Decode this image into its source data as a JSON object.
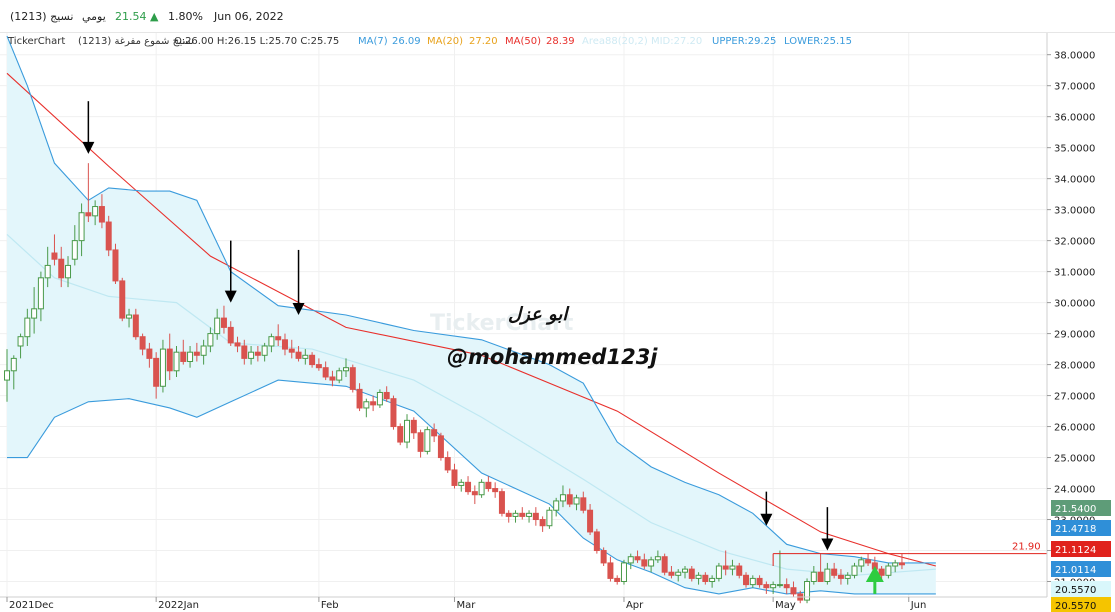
{
  "header": {
    "symbol": "نسيج (1213)",
    "period": "يومي",
    "price": "21.54",
    "change_arrow": "▲",
    "change": "1.80%",
    "date": "Jun 06, 2022"
  },
  "legend": {
    "source": "TickerChart",
    "description": "نسيج شموع مفرغة (1213)",
    "ohlc": "O:26.00 H:26.15 L:25.70 C:25.75",
    "ma7": "MA(7)",
    "ma7_value": "26.09",
    "ma20": "MA(20)",
    "ma20_value": "27.20",
    "ma50": "MA(50)",
    "ma50_value": "28.39",
    "faded": "Area88(20,2) MID:27.20",
    "upper": "UPPER:29.25",
    "lower": "LOWER:25.15"
  },
  "colors": {
    "up": "#4a9a4a",
    "down": "#d9534f",
    "ma50": "#e8302c",
    "band": "#3a9bdc",
    "band_fill": "#e3f6fb",
    "mid": "#bfe8f2",
    "accent_green": "#2ecc40"
  },
  "annotations": {
    "author_arabic": "ابو عزل",
    "handle": "@mohammed123j",
    "watermark": "TickerChart",
    "resistance_label": "21.90"
  },
  "price_tags": [
    {
      "label": "21.5400",
      "value": 21.54,
      "bg": "#5e9c78"
    },
    {
      "label": "21.4718",
      "value": 21.4718,
      "bg": "#2f8fd8"
    },
    {
      "label": "21.1124",
      "value": 21.1124,
      "bg": "#e0221c"
    },
    {
      "label": "21.0114",
      "value": 21.0114,
      "bg": "#2f8fd8"
    },
    {
      "label": "20.5570",
      "value": 20.557,
      "bg": "#d9f7fb"
    },
    {
      "label": "20.5570",
      "value": 20.557,
      "bg": "#f5c400"
    }
  ],
  "chart_data": {
    "type": "candlestick",
    "ylim": [
      20.5,
      38.7
    ],
    "y_ticks": [
      38,
      37,
      36,
      35,
      34,
      33,
      32,
      31,
      30,
      29,
      28,
      27,
      26,
      25,
      24,
      23,
      22,
      21
    ],
    "x_month_labels": [
      {
        "label": "2021Dec",
        "index": 0
      },
      {
        "label": "2022Jan",
        "index": 22
      },
      {
        "label": "Feb",
        "index": 46
      },
      {
        "label": "Mar",
        "index": 66
      },
      {
        "label": "Apr",
        "index": 91
      },
      {
        "label": "May",
        "index": 113
      },
      {
        "label": "Jun",
        "index": 133
      }
    ],
    "candles": [
      [
        27.5,
        28.5,
        26.8,
        27.8
      ],
      [
        27.8,
        28.3,
        27.2,
        28.2
      ],
      [
        28.6,
        29.0,
        28.2,
        28.9
      ],
      [
        28.9,
        29.8,
        28.6,
        29.5
      ],
      [
        29.5,
        30.5,
        29.0,
        29.8
      ],
      [
        29.8,
        31.0,
        29.4,
        30.8
      ],
      [
        30.8,
        31.8,
        30.5,
        31.2
      ],
      [
        31.6,
        32.2,
        31.2,
        31.4
      ],
      [
        31.4,
        31.8,
        30.5,
        30.8
      ],
      [
        30.8,
        31.5,
        30.5,
        31.2
      ],
      [
        31.4,
        32.5,
        31.2,
        32.0
      ],
      [
        32.0,
        33.2,
        31.5,
        32.9
      ],
      [
        32.9,
        34.5,
        32.6,
        32.8
      ],
      [
        32.8,
        33.3,
        32.5,
        33.1
      ],
      [
        33.1,
        33.5,
        32.4,
        32.6
      ],
      [
        32.6,
        32.8,
        31.5,
        31.7
      ],
      [
        31.7,
        31.9,
        30.6,
        30.7
      ],
      [
        30.7,
        30.8,
        29.4,
        29.5
      ],
      [
        29.5,
        29.8,
        29.2,
        29.6
      ],
      [
        29.6,
        29.8,
        28.8,
        28.9
      ],
      [
        28.9,
        29.0,
        28.3,
        28.5
      ],
      [
        28.5,
        28.7,
        27.9,
        28.2
      ],
      [
        28.2,
        28.4,
        26.9,
        27.3
      ],
      [
        27.3,
        28.8,
        27.1,
        28.5
      ],
      [
        28.5,
        29.0,
        27.5,
        27.8
      ],
      [
        27.8,
        28.6,
        27.6,
        28.4
      ],
      [
        28.4,
        28.8,
        28.0,
        28.1
      ],
      [
        28.1,
        28.6,
        27.9,
        28.4
      ],
      [
        28.4,
        28.7,
        28.1,
        28.3
      ],
      [
        28.3,
        28.8,
        28.0,
        28.6
      ],
      [
        28.6,
        29.2,
        28.4,
        29.0
      ],
      [
        29.0,
        29.8,
        28.8,
        29.5
      ],
      [
        29.5,
        29.9,
        29.0,
        29.2
      ],
      [
        29.2,
        29.4,
        28.6,
        28.7
      ],
      [
        28.7,
        28.9,
        28.4,
        28.6
      ],
      [
        28.6,
        28.8,
        28.0,
        28.2
      ],
      [
        28.2,
        28.6,
        28.0,
        28.4
      ],
      [
        28.4,
        28.6,
        28.1,
        28.3
      ],
      [
        28.3,
        28.7,
        28.1,
        28.6
      ],
      [
        28.6,
        29.0,
        28.4,
        28.9
      ],
      [
        28.9,
        29.3,
        28.6,
        28.8
      ],
      [
        28.8,
        29.0,
        28.3,
        28.5
      ],
      [
        28.5,
        28.8,
        28.2,
        28.4
      ],
      [
        28.4,
        28.6,
        28.1,
        28.2
      ],
      [
        28.2,
        28.5,
        28.0,
        28.3
      ],
      [
        28.3,
        28.4,
        27.9,
        28.0
      ],
      [
        28.0,
        28.2,
        27.8,
        27.9
      ],
      [
        27.9,
        28.1,
        27.5,
        27.6
      ],
      [
        27.6,
        27.8,
        27.3,
        27.5
      ],
      [
        27.5,
        27.9,
        27.4,
        27.8
      ],
      [
        27.8,
        28.2,
        27.6,
        27.9
      ],
      [
        27.9,
        28.0,
        27.1,
        27.2
      ],
      [
        27.2,
        27.4,
        26.5,
        26.6
      ],
      [
        26.6,
        26.9,
        26.3,
        26.8
      ],
      [
        26.8,
        27.0,
        26.5,
        26.7
      ],
      [
        26.7,
        27.2,
        26.6,
        27.1
      ],
      [
        27.1,
        27.3,
        26.8,
        26.9
      ],
      [
        26.9,
        27.0,
        25.9,
        26.0
      ],
      [
        26.0,
        26.1,
        25.4,
        25.5
      ],
      [
        25.5,
        26.4,
        25.3,
        26.2
      ],
      [
        26.2,
        26.3,
        25.6,
        25.8
      ],
      [
        25.8,
        25.9,
        25.0,
        25.2
      ],
      [
        25.2,
        26.0,
        25.1,
        25.9
      ],
      [
        25.9,
        26.1,
        25.5,
        25.7
      ],
      [
        25.7,
        25.8,
        24.9,
        25.0
      ],
      [
        25.0,
        25.2,
        24.5,
        24.6
      ],
      [
        24.6,
        24.8,
        24.0,
        24.1
      ],
      [
        24.1,
        24.3,
        23.9,
        24.2
      ],
      [
        24.2,
        24.4,
        23.8,
        23.9
      ],
      [
        23.9,
        24.1,
        23.5,
        23.8
      ],
      [
        23.8,
        24.3,
        23.7,
        24.2
      ],
      [
        24.2,
        24.4,
        23.9,
        24.0
      ],
      [
        24.0,
        24.2,
        23.7,
        23.9
      ],
      [
        23.9,
        24.0,
        23.1,
        23.2
      ],
      [
        23.2,
        23.3,
        22.9,
        23.1
      ],
      [
        23.1,
        23.3,
        22.9,
        23.2
      ],
      [
        23.2,
        23.4,
        23.0,
        23.1
      ],
      [
        23.1,
        23.3,
        22.9,
        23.2
      ],
      [
        23.2,
        23.4,
        22.8,
        23.0
      ],
      [
        23.0,
        23.1,
        22.6,
        22.8
      ],
      [
        22.8,
        23.4,
        22.7,
        23.3
      ],
      [
        23.3,
        23.7,
        23.1,
        23.6
      ],
      [
        23.6,
        24.1,
        23.4,
        23.8
      ],
      [
        23.8,
        24.0,
        23.4,
        23.5
      ],
      [
        23.5,
        23.8,
        23.3,
        23.7
      ],
      [
        23.7,
        23.9,
        23.2,
        23.3
      ],
      [
        23.3,
        23.5,
        22.5,
        22.6
      ],
      [
        22.6,
        22.7,
        21.9,
        22.0
      ],
      [
        22.0,
        22.1,
        21.5,
        21.6
      ],
      [
        21.6,
        21.8,
        21.0,
        21.1
      ],
      [
        21.1,
        21.2,
        20.9,
        21.0
      ],
      [
        21.0,
        21.7,
        20.9,
        21.6
      ],
      [
        21.6,
        21.9,
        21.4,
        21.8
      ],
      [
        21.8,
        22.0,
        21.6,
        21.7
      ],
      [
        21.7,
        21.9,
        21.4,
        21.5
      ],
      [
        21.5,
        21.8,
        21.3,
        21.7
      ],
      [
        21.7,
        22.0,
        21.6,
        21.8
      ],
      [
        21.8,
        21.9,
        21.2,
        21.3
      ],
      [
        21.3,
        21.5,
        21.1,
        21.2
      ],
      [
        21.2,
        21.4,
        21.0,
        21.3
      ],
      [
        21.3,
        21.5,
        21.1,
        21.4
      ],
      [
        21.4,
        21.5,
        21.0,
        21.1
      ],
      [
        21.1,
        21.3,
        20.9,
        21.2
      ],
      [
        21.2,
        21.3,
        20.9,
        21.0
      ],
      [
        21.0,
        21.2,
        20.8,
        21.1
      ],
      [
        21.1,
        21.6,
        21.0,
        21.5
      ],
      [
        21.5,
        22.0,
        21.2,
        21.4
      ],
      [
        21.4,
        21.7,
        21.2,
        21.5
      ],
      [
        21.5,
        21.6,
        21.1,
        21.2
      ],
      [
        21.2,
        21.3,
        20.8,
        20.9
      ],
      [
        20.9,
        21.2,
        20.8,
        21.1
      ],
      [
        21.1,
        21.2,
        20.8,
        20.9
      ],
      [
        20.9,
        21.0,
        20.6,
        20.8
      ],
      [
        20.8,
        21.0,
        20.6,
        20.9
      ],
      [
        20.9,
        22.0,
        20.8,
        20.9
      ],
      [
        20.9,
        21.1,
        20.6,
        20.8
      ],
      [
        20.8,
        21.0,
        20.5,
        20.6
      ],
      [
        20.6,
        20.7,
        20.3,
        20.4
      ],
      [
        20.4,
        21.1,
        20.3,
        21.0
      ],
      [
        21.0,
        21.5,
        20.9,
        21.3
      ],
      [
        21.3,
        21.9,
        21.1,
        21.0
      ],
      [
        21.0,
        21.6,
        20.9,
        21.4
      ],
      [
        21.4,
        21.6,
        21.1,
        21.2
      ],
      [
        21.2,
        21.4,
        20.9,
        21.1
      ],
      [
        21.1,
        21.3,
        20.9,
        21.2
      ],
      [
        21.2,
        21.6,
        21.1,
        21.5
      ],
      [
        21.5,
        21.8,
        21.3,
        21.7
      ],
      [
        21.7,
        21.9,
        21.5,
        21.6
      ],
      [
        21.6,
        21.8,
        21.3,
        21.4
      ],
      [
        21.4,
        21.5,
        21.0,
        21.2
      ],
      [
        21.2,
        21.6,
        21.1,
        21.5
      ],
      [
        21.5,
        21.7,
        21.3,
        21.6
      ],
      [
        21.6,
        21.9,
        21.4,
        21.54
      ]
    ],
    "series": [
      {
        "name": "MA(50)",
        "color": "#e8302c",
        "points": [
          [
            0,
            37.4
          ],
          [
            15,
            34.4
          ],
          [
            30,
            31.5
          ],
          [
            50,
            29.2
          ],
          [
            70,
            28.3
          ],
          [
            90,
            26.5
          ],
          [
            105,
            24.5
          ],
          [
            120,
            22.6
          ],
          [
            130,
            21.9
          ],
          [
            137,
            21.5
          ]
        ]
      },
      {
        "name": "UPPER",
        "color": "#3a9bdc",
        "points": [
          [
            0,
            38.6
          ],
          [
            3,
            37.0
          ],
          [
            7,
            34.5
          ],
          [
            12,
            33.3
          ],
          [
            15,
            33.7
          ],
          [
            20,
            33.6
          ],
          [
            24,
            33.6
          ],
          [
            28,
            33.3
          ],
          [
            33,
            31.0
          ],
          [
            40,
            29.9
          ],
          [
            50,
            29.6
          ],
          [
            60,
            29.1
          ],
          [
            70,
            28.8
          ],
          [
            80,
            28.0
          ],
          [
            85,
            27.4
          ],
          [
            90,
            25.5
          ],
          [
            95,
            24.7
          ],
          [
            100,
            24.2
          ],
          [
            105,
            23.8
          ],
          [
            110,
            23.2
          ],
          [
            115,
            22.2
          ],
          [
            120,
            21.9
          ],
          [
            125,
            21.8
          ],
          [
            130,
            21.6
          ],
          [
            137,
            21.6
          ]
        ]
      },
      {
        "name": "LOWER",
        "color": "#3a9bdc",
        "points": [
          [
            0,
            25.0
          ],
          [
            3,
            25.0
          ],
          [
            7,
            26.3
          ],
          [
            12,
            26.8
          ],
          [
            18,
            26.9
          ],
          [
            24,
            26.6
          ],
          [
            28,
            26.3
          ],
          [
            33,
            26.8
          ],
          [
            40,
            27.5
          ],
          [
            50,
            27.3
          ],
          [
            60,
            26.5
          ],
          [
            70,
            24.5
          ],
          [
            80,
            23.5
          ],
          [
            85,
            22.4
          ],
          [
            90,
            21.7
          ],
          [
            95,
            21.3
          ],
          [
            100,
            20.8
          ],
          [
            105,
            20.6
          ],
          [
            110,
            20.8
          ],
          [
            115,
            20.6
          ],
          [
            120,
            20.7
          ],
          [
            125,
            20.6
          ],
          [
            130,
            20.6
          ],
          [
            137,
            20.6
          ]
        ]
      },
      {
        "name": "MID",
        "color": "#bfe8f2",
        "points": [
          [
            0,
            32.2
          ],
          [
            7,
            30.8
          ],
          [
            15,
            30.2
          ],
          [
            25,
            30.0
          ],
          [
            33,
            28.7
          ],
          [
            45,
            28.5
          ],
          [
            60,
            27.5
          ],
          [
            70,
            26.3
          ],
          [
            85,
            24.3
          ],
          [
            95,
            22.9
          ],
          [
            105,
            22.0
          ],
          [
            115,
            21.4
          ],
          [
            125,
            21.2
          ],
          [
            137,
            21.4
          ]
        ]
      }
    ],
    "resistance_line": 21.9,
    "resistance_from_index": 113,
    "down_arrows": [
      {
        "index": 12,
        "y_top": 36.5,
        "y_tip": 34.8
      },
      {
        "index": 33,
        "y_top": 32.0,
        "y_tip": 30.0
      },
      {
        "index": 43,
        "y_top": 31.7,
        "y_tip": 29.6
      },
      {
        "index": 112,
        "y_top": 23.9,
        "y_tip": 22.8
      },
      {
        "index": 121,
        "y_top": 23.4,
        "y_tip": 22.0
      }
    ],
    "up_arrow": {
      "index": 128,
      "y_bottom": 20.6,
      "y_tip": 21.5
    }
  }
}
